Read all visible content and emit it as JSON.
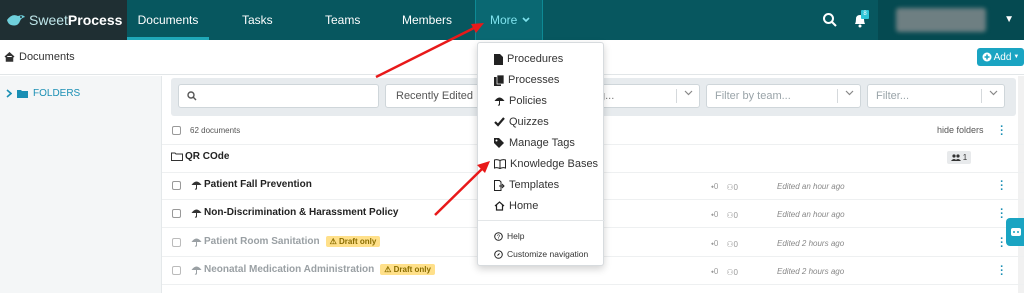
{
  "brand": {
    "sweet": "Sweet",
    "process": "Process"
  },
  "nav": {
    "items": [
      "Documents",
      "Tasks",
      "Teams",
      "Members"
    ],
    "more_label": "More",
    "notification_count": "8"
  },
  "breadcrumb": {
    "title": "Documents"
  },
  "add_button": {
    "label": "Add"
  },
  "sidebar": {
    "folders_label": "FOLDERS"
  },
  "filters": {
    "search_placeholder": "",
    "sort_value": "Recently Edited",
    "tag_partial": "g...",
    "team_placeholder": "Filter by team...",
    "filter_placeholder": "Filter..."
  },
  "list": {
    "count_label": "62 documents",
    "hide_folders": "hide folders",
    "folder": {
      "name": "QR COde",
      "members": "1"
    },
    "rows": [
      {
        "name": "Patient Fall Prevention",
        "draft": "",
        "tags": "0",
        "members": "0",
        "edited": "Edited an hour ago"
      },
      {
        "name": "Non-Discrimination & Harassment Policy",
        "draft": "",
        "tags": "0",
        "members": "0",
        "edited": "Edited an hour ago"
      },
      {
        "name": "Patient Room Sanitation",
        "draft": "Draft only",
        "tags": "0",
        "members": "0",
        "edited": "Edited 2 hours ago"
      },
      {
        "name": "Neonatal Medication Administration",
        "draft": "Draft only",
        "tags": "0",
        "members": "0",
        "edited": "Edited 2 hours ago"
      }
    ]
  },
  "more_menu": {
    "items": [
      "Procedures",
      "Processes",
      "Policies",
      "Quizzes",
      "Manage Tags",
      "Knowledge Bases",
      "Templates",
      "Home"
    ],
    "help": "Help",
    "customize": "Customize navigation"
  },
  "colors": {
    "topbar": "#07575f",
    "accent": "#1aa4c2",
    "arrow": "#e8191a"
  }
}
